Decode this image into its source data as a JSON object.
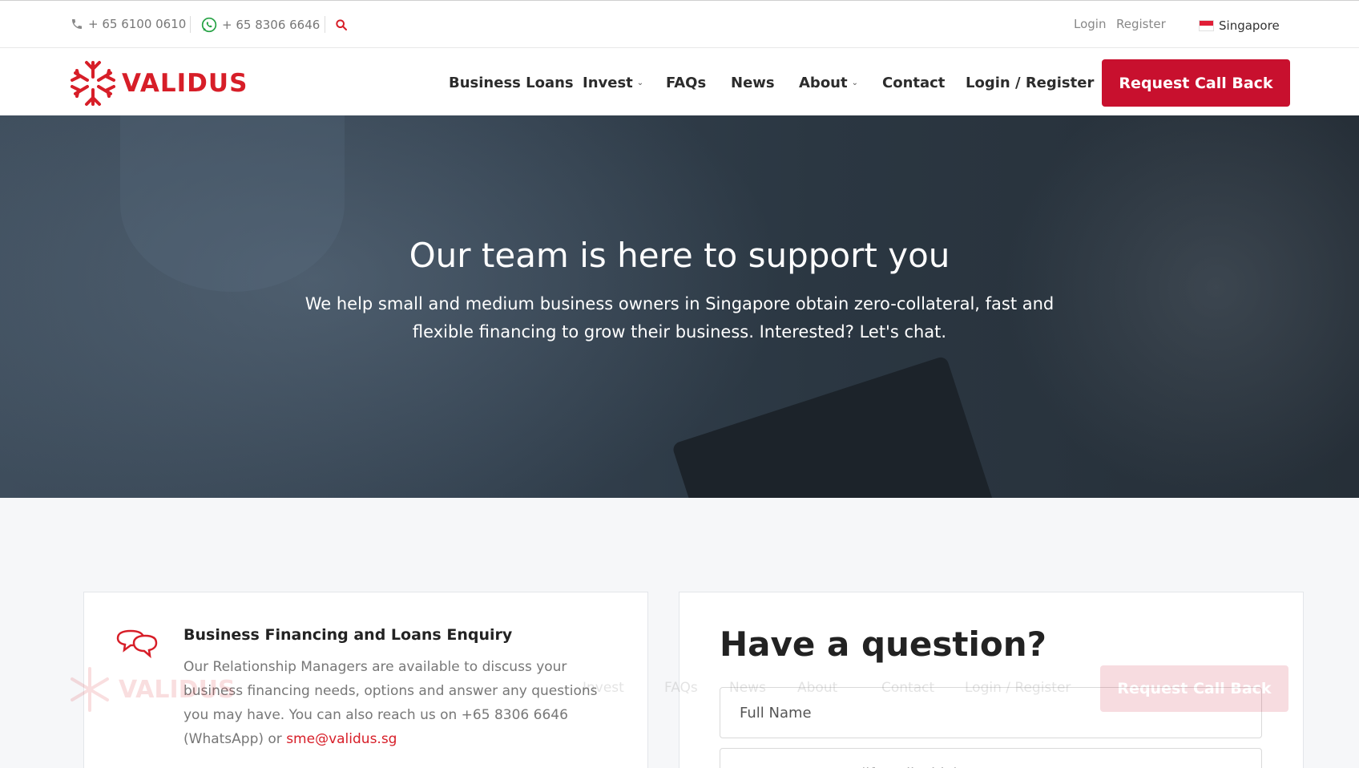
{
  "topbar": {
    "phone": "+ 65 6100 0610",
    "whatsapp": "+ 65 8306 6646",
    "login": "Login",
    "register": "Register",
    "country": "Singapore"
  },
  "nav": {
    "logo_text": "VALIDUS",
    "items": [
      {
        "label": "Business Loans"
      },
      {
        "label": "Invest",
        "dropdown": true
      },
      {
        "label": "FAQs"
      },
      {
        "label": "News"
      },
      {
        "label": "About",
        "dropdown": true
      },
      {
        "label": "Contact"
      },
      {
        "label": "Login / Register"
      }
    ],
    "cta": "Request Call Back"
  },
  "hero": {
    "title": "Our team is here to support you",
    "subtitle": "We help small and medium business owners in Singapore obtain zero-collateral, fast and flexible financing to grow their business. Interested? Let's chat."
  },
  "enquiry": {
    "title": "Business Financing and Loans Enquiry",
    "body": "Our Relationship Managers are available to discuss your business financing needs, options and answer any questions you may have. You can also reach us on +65 8306 6646 (WhatsApp) or ",
    "email": "sme@validus.sg"
  },
  "form": {
    "title": "Have a question?",
    "full_name_placeholder": "Full Name",
    "company_placeholder": "Company Name (if applicable)"
  },
  "colors": {
    "brand_red": "#c8102e",
    "whatsapp_green": "#25a244"
  }
}
